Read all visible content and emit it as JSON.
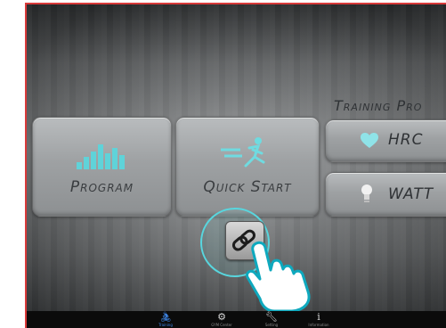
{
  "main": {
    "tiles": {
      "program_label": "Program",
      "quick_start_label": "Quick Start"
    },
    "training_programs": {
      "title": "Training Pro",
      "hrc_label": "HRC",
      "watt_label": "WATT"
    }
  },
  "nav": {
    "items": [
      {
        "label": "Training",
        "icon": "cyclist-icon"
      },
      {
        "label": "GYM Center",
        "icon": "gears-icon"
      },
      {
        "label": "Setting",
        "icon": "wrench-icon"
      },
      {
        "label": "Information",
        "icon": "info-icon"
      }
    ]
  },
  "colors": {
    "accent_cyan": "#58d6de",
    "frame_red": "#d93a3a",
    "nav_active": "#3e86e8",
    "navbar_bg": "#0b0b0b"
  }
}
